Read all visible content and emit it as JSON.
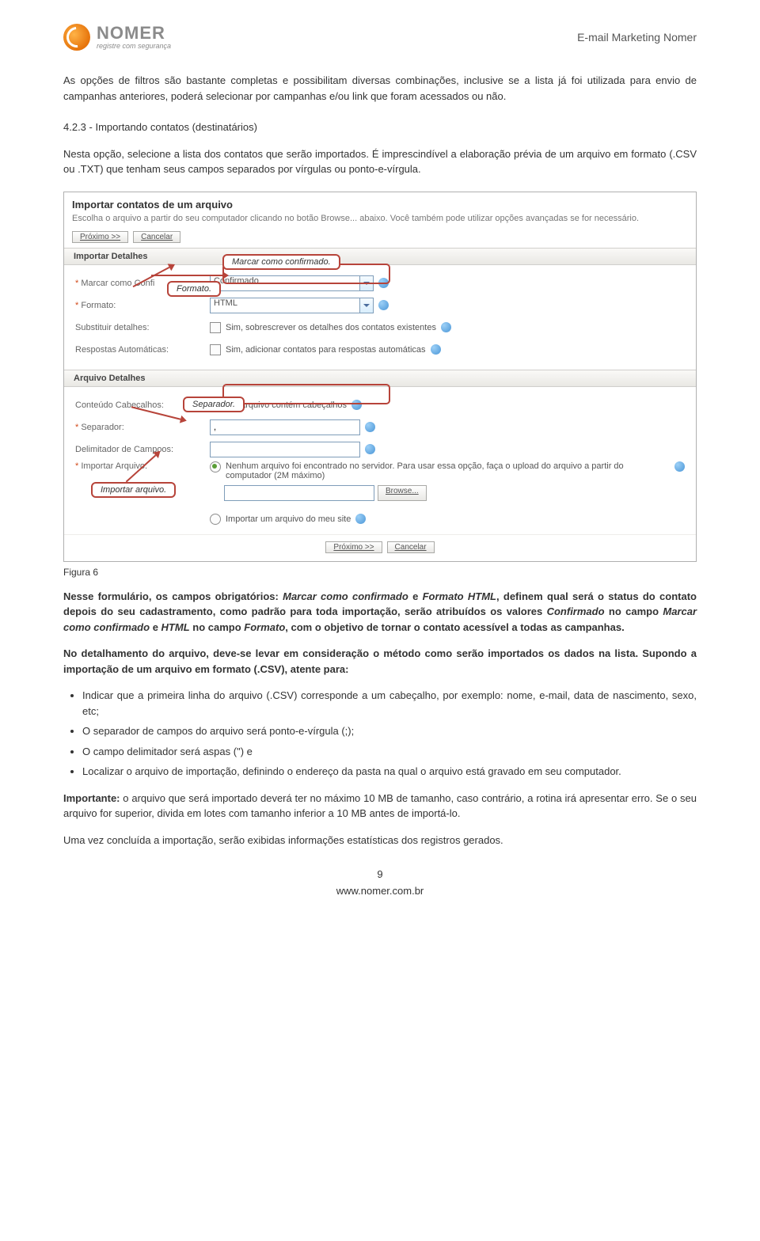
{
  "logo": {
    "name": "NOMER",
    "tagline": "registre com segurança"
  },
  "doc_title": "E-mail Marketing Nomer",
  "para1": "As opções de filtros são bastante completas e possibilitam diversas combinações, inclusive se a lista já foi utilizada para envio de campanhas anteriores, poderá selecionar por campanhas e/ou link que foram acessados ou não.",
  "section_h": "4.2.3 - Importando contatos (destinatários)",
  "para2": "Nesta opção, selecione a lista dos contatos que serão importados. É imprescindível a elaboração prévia de um arquivo em formato (.CSV ou .TXT) que tenham seus campos separados por vírgulas ou ponto-e-vírgula.",
  "screenshot": {
    "title": "Importar contatos de um arquivo",
    "desc": "Escolha o arquivo a partir do seu computador clicando no botão Browse... abaixo. Você também pode utilizar opções avançadas se for necessário.",
    "btn_next": "Próximo >>",
    "btn_cancel": "Cancelar",
    "sec1": "Importar Detalhes",
    "label_marcar": "Marcar como Confi",
    "val_confirmado": "Confirmado",
    "label_formato": "Formato:",
    "val_formato": "HTML",
    "label_subst": "Substituir detalhes:",
    "chk_subst": "Sim, sobrescrever os detalhes dos contatos existentes",
    "label_resp": "Respostas Automáticas:",
    "chk_resp": "Sim, adicionar contatos para respostas automáticas",
    "sec2": "Arquivo Detalhes",
    "label_conteudo": "Conteúdo Cabeçalhos:",
    "chk_conteudo": "m, este arquivo contém cabeçalhos",
    "label_separador": "Separador:",
    "val_separador": ",",
    "label_delim": "Delimitador de Campoos:",
    "label_import": "Importar Arquivo:",
    "radio1_text": "Nenhum arquivo foi encontrado no servidor. Para usar essa opção, faça o upload do arquivo a partir do computador (2M máximo)",
    "browse_btn": "Browse...",
    "radio2_text": "Importar um arquivo do meu site",
    "callouts": {
      "c1": "Marcar como confirmado.",
      "c2": "Formato.",
      "c3": "Separador.",
      "c4": "Importar arquivo."
    }
  },
  "fig_label": "Figura 6",
  "para3_prefix": "Nesse formulário, os campos obrigatórios: ",
  "para3_em1": "Marcar como confirmado",
  "para3_mid1": " e ",
  "para3_em2": "Formato HTML",
  "para3_mid2": ", definem qual será o status do contato depois do seu cadastramento, como padrão para toda importação, serão atribuídos os valores ",
  "para3_em3": "Confirmado",
  "para3_mid3": " no campo ",
  "para3_em4": "Marcar como confirmado",
  "para3_mid4": " e ",
  "para3_em5": "HTML",
  "para3_mid5": " no campo ",
  "para3_em6": "Formato",
  "para3_suffix": ", com o objetivo de tornar o contato acessível a todas as campanhas.",
  "para4": "No detalhamento do arquivo, deve-se levar em consideração o método como serão importados os dados na lista. Supondo a importação de um arquivo em formato (.CSV), atente para:",
  "bullets": [
    "Indicar que a primeira linha do arquivo (.CSV) corresponde a um cabeçalho, por exemplo: nome, e-mail, data de nascimento, sexo, etc;",
    "O separador de campos do arquivo será ponto-e-vírgula (;);",
    "O campo delimitador será aspas (\") e",
    "Localizar o arquivo de importação, definindo o endereço da pasta na qual o arquivo está gravado em seu computador."
  ],
  "para5_prefix": "Importante:",
  "para5": " o arquivo que será importado deverá ter no máximo 10 MB de tamanho, caso contrário, a rotina irá apresentar erro. Se o seu arquivo for superior, divida em lotes com tamanho inferior a 10 MB antes de importá-lo.",
  "para6": "Uma vez concluída a importação, serão exibidas informações estatísticas dos registros gerados.",
  "page_num": "9",
  "footer_url": "www.nomer.com.br"
}
